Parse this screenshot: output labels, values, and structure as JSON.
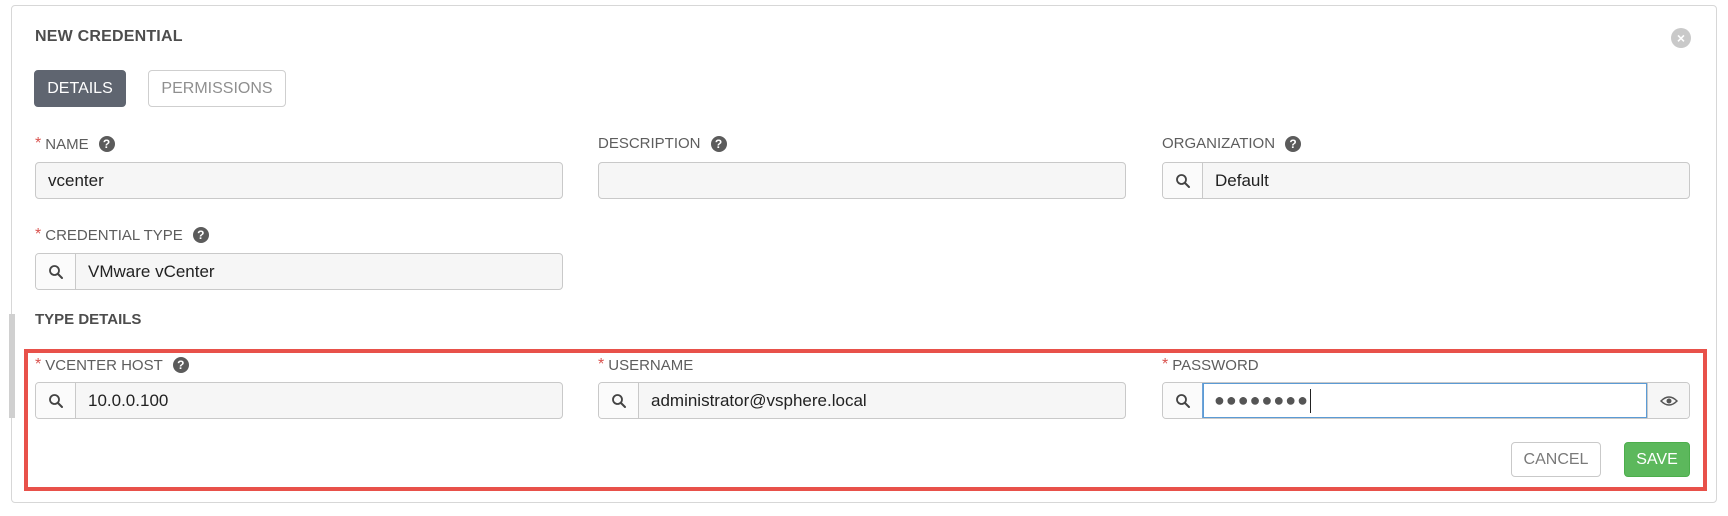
{
  "dialog": {
    "title": "NEW CREDENTIAL"
  },
  "tabs": [
    {
      "label": "DETAILS",
      "active": true
    },
    {
      "label": "PERMISSIONS",
      "active": false
    }
  ],
  "fields": {
    "name": {
      "label": "NAME",
      "value": "vcenter",
      "required": true
    },
    "description": {
      "label": "DESCRIPTION",
      "value": "",
      "required": false
    },
    "organization": {
      "label": "ORGANIZATION",
      "value": "Default",
      "required": false
    },
    "credential_type": {
      "label": "CREDENTIAL TYPE",
      "value": "VMware vCenter",
      "required": true
    }
  },
  "type_details": {
    "title": "TYPE DETAILS",
    "vcenter_host": {
      "label": "VCENTER HOST",
      "value": "10.0.0.100",
      "required": true
    },
    "username": {
      "label": "USERNAME",
      "value": "administrator@vsphere.local",
      "required": true
    },
    "password": {
      "label": "PASSWORD",
      "value": "●●●●●●●●",
      "required": true
    }
  },
  "buttons": {
    "cancel": "CANCEL",
    "save": "SAVE"
  },
  "icons": {
    "required_marker": "*",
    "help": "?",
    "close": "×",
    "search": "search-icon",
    "eye": "eye-icon"
  },
  "colors": {
    "accent_active_tab": "#5f6570",
    "save_green": "#5cb85c",
    "required_red": "#d9534f",
    "highlight_red": "#e8514a",
    "focus_blue": "#5b9bd5"
  }
}
